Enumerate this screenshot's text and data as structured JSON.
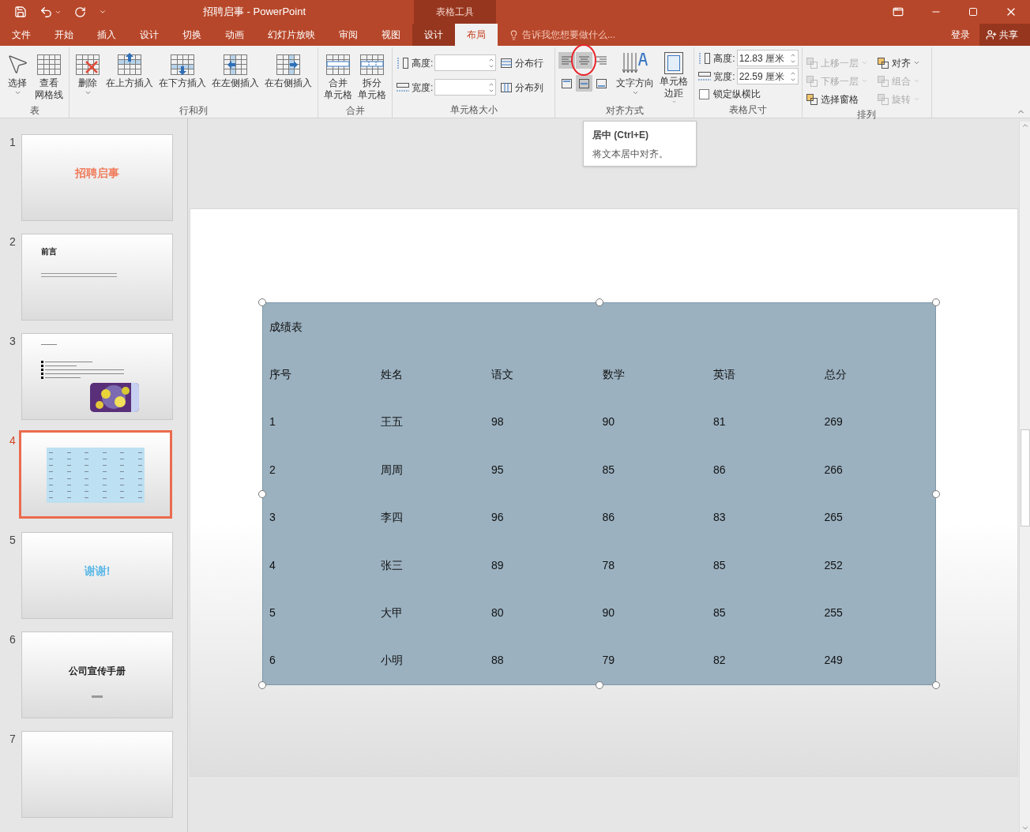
{
  "window": {
    "title": "招聘启事 - PowerPoint",
    "context_group": "表格工具"
  },
  "tabs": [
    {
      "label": "文件",
      "selected": false,
      "context": false
    },
    {
      "label": "开始",
      "selected": false,
      "context": false
    },
    {
      "label": "插入",
      "selected": false,
      "context": false
    },
    {
      "label": "设计",
      "selected": false,
      "context": false
    },
    {
      "label": "切换",
      "selected": false,
      "context": false
    },
    {
      "label": "动画",
      "selected": false,
      "context": false
    },
    {
      "label": "幻灯片放映",
      "selected": false,
      "context": false
    },
    {
      "label": "审阅",
      "selected": false,
      "context": false
    },
    {
      "label": "视图",
      "selected": false,
      "context": false
    },
    {
      "label": "设计",
      "selected": false,
      "context": true
    },
    {
      "label": "布局",
      "selected": true,
      "context": true
    }
  ],
  "tell_me": {
    "placeholder": "告诉我您想要做什么..."
  },
  "sign_in": "登录",
  "share": "共享",
  "ribbon": [
    {
      "label": "表",
      "items": [
        {
          "kind": "big",
          "lines": [
            "选择"
          ],
          "dropdown": true
        },
        {
          "kind": "big",
          "lines": [
            "查看",
            "网格线"
          ],
          "dropdown": false
        }
      ]
    },
    {
      "label": "行和列",
      "items": [
        {
          "kind": "big",
          "lines": [
            "删除"
          ],
          "dropdown": true
        },
        {
          "kind": "big",
          "lines": [
            "在上方插入"
          ],
          "dropdown": false
        },
        {
          "kind": "big",
          "lines": [
            "在下方插入"
          ],
          "dropdown": false
        },
        {
          "kind": "big",
          "lines": [
            "在左侧插入"
          ],
          "dropdown": false
        },
        {
          "kind": "big",
          "lines": [
            "在右侧插入"
          ],
          "dropdown": false
        }
      ]
    },
    {
      "label": "合并",
      "items": [
        {
          "kind": "big",
          "lines": [
            "合并",
            "单元格"
          ],
          "dropdown": false
        },
        {
          "kind": "big",
          "lines": [
            "拆分",
            "单元格"
          ],
          "dropdown": false
        }
      ]
    },
    {
      "label": "单元格大小",
      "items": [
        {
          "kind": "fields",
          "fields": [
            {
              "label": "高度:"
            },
            {
              "label": "宽度:"
            }
          ]
        },
        {
          "kind": "smalls",
          "buttons": [
            {
              "label": "分布行"
            },
            {
              "label": "分布列"
            }
          ]
        }
      ]
    },
    {
      "label": "对齐方式",
      "items": [
        {
          "kind": "align",
          "buttons": [
            {
              "selected": true
            },
            {
              "selected": true
            },
            {
              "selected": false
            },
            {
              "selected": false
            },
            {
              "selected": true
            },
            {
              "selected": false
            }
          ]
        },
        {
          "kind": "big",
          "lines": [
            "文字方向"
          ],
          "dropdown": true
        },
        {
          "kind": "big",
          "lines": [
            "单元格",
            "边距"
          ],
          "dropdown": true
        }
      ]
    },
    {
      "label": "表格尺寸",
      "items": [
        {
          "kind": "size",
          "fields": [
            {
              "label": "高度:",
              "value": "12.83 厘米"
            },
            {
              "label": "宽度:",
              "value": "22.59 厘米"
            }
          ],
          "checkbox": {
            "label": "锁定纵横比",
            "checked": false
          }
        }
      ]
    },
    {
      "label": "排列",
      "items": [
        {
          "kind": "smalls",
          "buttons": [
            {
              "label": "上移一层",
              "dropdown": true,
              "disabled": true
            },
            {
              "label": "下移一层",
              "dropdown": true,
              "disabled": true
            },
            {
              "label": "选择窗格",
              "dropdown": false,
              "disabled": false
            }
          ]
        },
        {
          "kind": "smalls",
          "buttons": [
            {
              "label": "对齐",
              "dropdown": true,
              "disabled": false
            },
            {
              "label": "组合",
              "dropdown": true,
              "disabled": true
            },
            {
              "label": "旋转",
              "dropdown": true,
              "disabled": true
            }
          ]
        }
      ]
    }
  ],
  "tooltip": {
    "title": "居中 (Ctrl+E)",
    "description": "将文本居中对齐。"
  },
  "slides": [
    {
      "number": "1",
      "selected": false,
      "kind": "title",
      "title": "招聘启事",
      "color": "#f07c5c"
    },
    {
      "number": "2",
      "selected": false,
      "kind": "heading",
      "title": "前言"
    },
    {
      "number": "3",
      "selected": false,
      "kind": "bullets"
    },
    {
      "number": "4",
      "selected": true,
      "kind": "table"
    },
    {
      "number": "5",
      "selected": false,
      "kind": "title",
      "title": "谢谢!",
      "color": "#5bb8e8"
    },
    {
      "number": "6",
      "selected": false,
      "kind": "title_sub",
      "title": "公司宣传手册",
      "color": "#222222"
    },
    {
      "number": "7",
      "selected": false,
      "kind": "blank"
    }
  ],
  "table": {
    "title": "成绩表",
    "columns": [
      "序号",
      "姓名",
      "语文",
      "数学",
      "英语",
      "总分"
    ],
    "rows": [
      [
        "1",
        "王五",
        "98",
        "90",
        "81",
        "269"
      ],
      [
        "2",
        "周周",
        "95",
        "85",
        "86",
        "266"
      ],
      [
        "3",
        "李四",
        "96",
        "86",
        "83",
        "265"
      ],
      [
        "4",
        "张三",
        "89",
        "78",
        "85",
        "252"
      ],
      [
        "5",
        "大甲",
        "80",
        "90",
        "85",
        "255"
      ],
      [
        "6",
        "小明",
        "88",
        "79",
        "82",
        "249"
      ]
    ]
  }
}
